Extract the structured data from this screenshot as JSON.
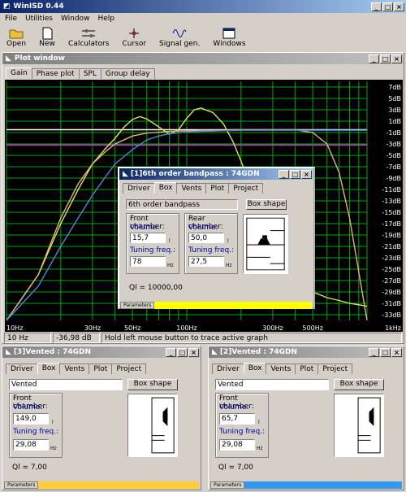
{
  "app": {
    "title": "WinISD 0.44",
    "menu": [
      "File",
      "Utilities",
      "Window",
      "Help"
    ],
    "toolbar": [
      {
        "label": "Open",
        "icon": "folder-open-icon"
      },
      {
        "label": "New",
        "icon": "new-document-icon"
      },
      {
        "label": "Calculators",
        "icon": "sliders-icon"
      },
      {
        "label": "Cursor",
        "icon": "crosshair-icon"
      },
      {
        "label": "Signal gen.",
        "icon": "signal-generator-icon"
      },
      {
        "label": "Windows",
        "icon": "windows-icon"
      }
    ]
  },
  "plot_window": {
    "title": "Plot window",
    "tabs": [
      "Gain",
      "Phase plot",
      "SPL",
      "Group delay"
    ],
    "active_tab": "Gain",
    "status": {
      "freq": "10 Hz",
      "value": "-36,98 dB",
      "hint": "Hold left mouse button to trace active graph"
    }
  },
  "chart_data": {
    "type": "line",
    "title": "",
    "xlabel": "",
    "ylabel": "",
    "x_scale": "log",
    "xlim": [
      10,
      1000
    ],
    "ylim": [
      -34,
      8
    ],
    "x_ticks": [
      "10Hz",
      "30Hz",
      "50Hz",
      "100Hz",
      "300Hz",
      "500Hz",
      "1kHz"
    ],
    "x_tick_values": [
      10,
      30,
      50,
      100,
      300,
      500,
      1000
    ],
    "y_ticks": [
      "7dB",
      "5dB",
      "3dB",
      "1dB",
      "-1dB",
      "-3dB",
      "-5dB",
      "-7dB",
      "-9dB",
      "-11dB",
      "-13dB",
      "-15dB",
      "-17dB",
      "-19dB",
      "-21dB",
      "-23dB",
      "-25dB",
      "-27dB",
      "-29dB",
      "-31dB",
      "-33dB"
    ],
    "y_tick_values": [
      7,
      5,
      3,
      1,
      -1,
      -3,
      -5,
      -7,
      -9,
      -11,
      -13,
      -15,
      -17,
      -19,
      -21,
      -23,
      -25,
      -27,
      -29,
      -31,
      -33
    ],
    "grid": true,
    "background": "#000000",
    "grid_color": "#00aa00",
    "reference_lines": [
      {
        "y": -0.5,
        "color": "#ffffff"
      },
      {
        "y": -3.2,
        "color": "#cc33cc"
      }
    ],
    "series": [
      {
        "color": "#e0e060",
        "x": [
          10,
          15,
          20,
          25,
          30,
          35,
          40,
          45,
          50,
          55,
          60,
          70,
          80,
          90,
          100,
          110,
          120,
          140,
          160,
          180,
          200,
          250,
          300,
          350,
          400,
          500,
          600,
          700,
          800,
          1000
        ],
        "y": [
          -36,
          -26,
          -17,
          -11,
          -6.5,
          -4,
          -2,
          0,
          1.3,
          1.8,
          1.4,
          0,
          -1.3,
          -0.5,
          1.5,
          3,
          3.3,
          2.5,
          0.5,
          -2.5,
          -6,
          -14,
          -20,
          -24,
          -27,
          -29,
          -30,
          -30.5,
          -31,
          -31.5
        ]
      },
      {
        "color": "#e8b080",
        "x": [
          10,
          15,
          20,
          25,
          30,
          35,
          40,
          50,
          60,
          80,
          100,
          120,
          140,
          160,
          180,
          200,
          250,
          300,
          400,
          500,
          600,
          700,
          800,
          1000
        ],
        "y": [
          -36,
          -26,
          -16,
          -10,
          -6.5,
          -4.5,
          -3,
          -1.6,
          -1.1,
          -0.8,
          -0.7,
          -0.6,
          -0.6,
          -0.6,
          -0.5,
          -0.5,
          -0.5,
          -0.5,
          -0.5,
          -1,
          -3,
          -8,
          -16,
          -36
        ]
      },
      {
        "color": "#4a88e0",
        "x": [
          10,
          15,
          20,
          25,
          30,
          35,
          40,
          50,
          60,
          70,
          80,
          100,
          120,
          150,
          200,
          300,
          500,
          1000
        ],
        "y": [
          -36,
          -28,
          -21,
          -16,
          -12,
          -9,
          -6.5,
          -4,
          -2.3,
          -1.6,
          -1.2,
          -0.9,
          -0.8,
          -0.7,
          -0.6,
          -0.6,
          -0.6,
          -0.6
        ]
      }
    ]
  },
  "dialogs": {
    "bandpass": {
      "title": "[1]6th order bandpass : 74GDN",
      "tabs": [
        "Driver",
        "Box",
        "Vents",
        "Plot",
        "Project"
      ],
      "active_tab": "Box",
      "box_type": "6th order bandpass",
      "box_shape_label": "Box shape",
      "front": {
        "title": "Front chamber:",
        "volume_label": "Volume:",
        "volume": "15,7",
        "volume_unit": "l",
        "tuning_label": "Tuning freq.:",
        "tuning": "78",
        "tuning_unit": "Hz"
      },
      "rear": {
        "title": "Rear chamber:",
        "volume_label": "Volume:",
        "volume": "50,0",
        "volume_unit": "l",
        "tuning_label": "Tuning freq.:",
        "tuning": "27,5",
        "tuning_unit": "Hz"
      },
      "ql": "Ql = 10000,00",
      "params_label": "Parameters",
      "params_color": "#ffff00"
    },
    "vented3": {
      "title": "[3]Vented : 74GDN",
      "tabs": [
        "Driver",
        "Box",
        "Vents",
        "Plot",
        "Project"
      ],
      "active_tab": "Box",
      "box_type": "Vented",
      "box_shape_label": "Box shape",
      "front": {
        "title": "Front chamber:",
        "volume_label": "Volume:",
        "volume": "149,0",
        "volume_unit": "l",
        "tuning_label": "Tuning freq.:",
        "tuning": "29,08",
        "tuning_unit": "Hz"
      },
      "ql": "Ql = 7,00",
      "params_label": "Parameters",
      "params_color": "#ffcc33"
    },
    "vented2": {
      "title": "[2]Vented : 74GDN",
      "tabs": [
        "Driver",
        "Box",
        "Vents",
        "Plot",
        "Project"
      ],
      "active_tab": "Box",
      "box_type": "Vented",
      "box_shape_label": "Box shape",
      "front": {
        "title": "Front chamber:",
        "volume_label": "Volume:",
        "volume": "65,7",
        "volume_unit": "l",
        "tuning_label": "Tuning freq.:",
        "tuning": "29,08",
        "tuning_unit": "Hz"
      },
      "ql": "Ql = 7,00",
      "params_label": "Parameters",
      "params_color": "#3399ee"
    }
  }
}
